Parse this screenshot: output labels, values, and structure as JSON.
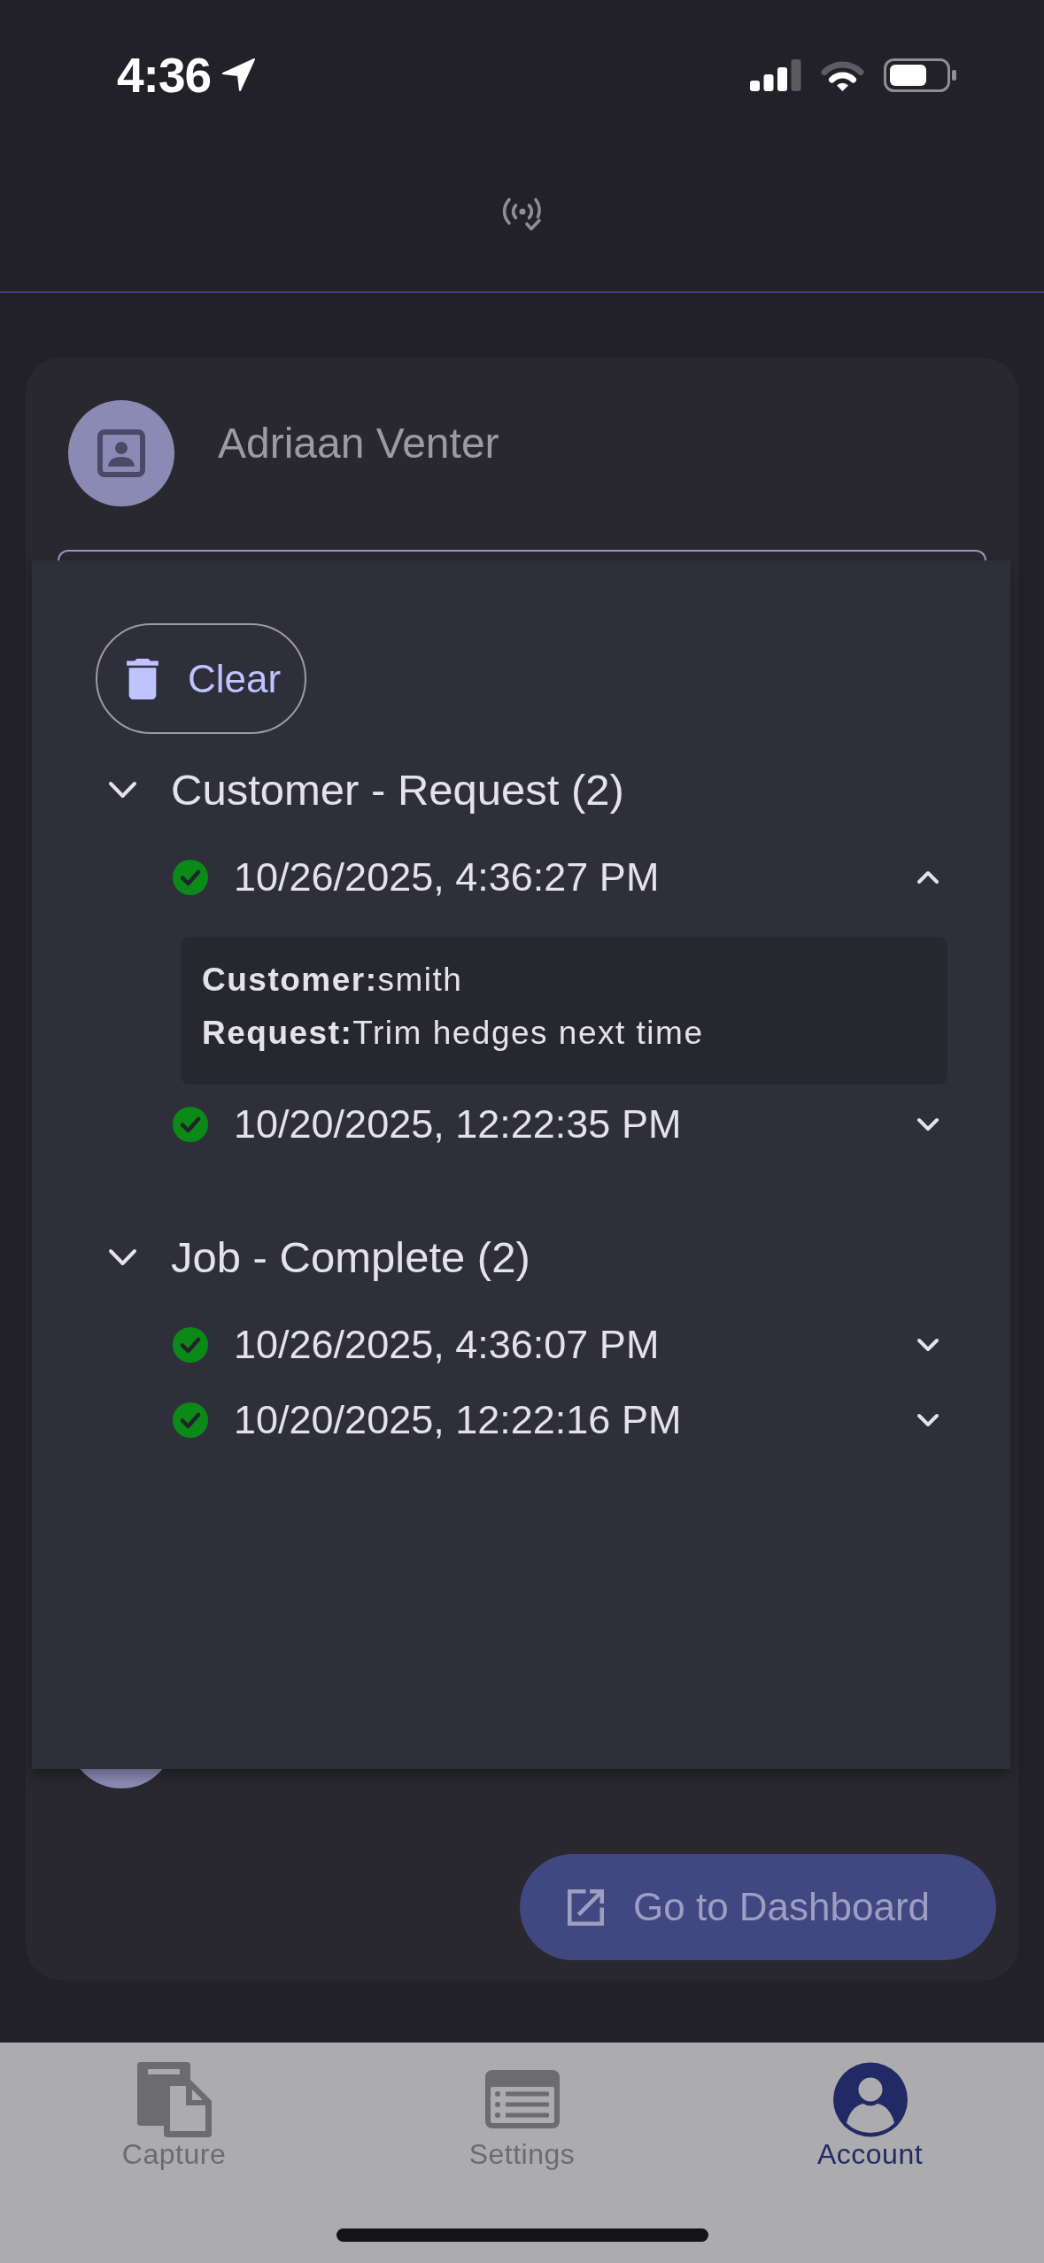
{
  "status_bar": {
    "time": "4:36"
  },
  "profile": {
    "name": "Adriaan Venter"
  },
  "history": {
    "clear_button": "Clear",
    "groups": [
      {
        "title": "Customer - Request (2)",
        "expanded": true,
        "entries": [
          {
            "timestamp": "10/26/2025, 4:36:27 PM",
            "expanded": true,
            "details": [
              "**Customer:**smith",
              "**Request:**Trim hedges next time"
            ]
          },
          {
            "timestamp": "10/20/2025, 12:22:35 PM",
            "expanded": false
          }
        ]
      },
      {
        "title": "Job - Complete (2)",
        "expanded": true,
        "entries": [
          {
            "timestamp": "10/26/2025, 4:36:07 PM",
            "expanded": false
          },
          {
            "timestamp": "10/20/2025, 12:22:16 PM",
            "expanded": false
          }
        ]
      }
    ]
  },
  "dashboard_button": "Go to Dashboard",
  "tab_bar": {
    "tabs": [
      {
        "label": "Capture",
        "selected": false
      },
      {
        "label": "Settings",
        "selected": false
      },
      {
        "label": "Account",
        "selected": true
      }
    ]
  }
}
